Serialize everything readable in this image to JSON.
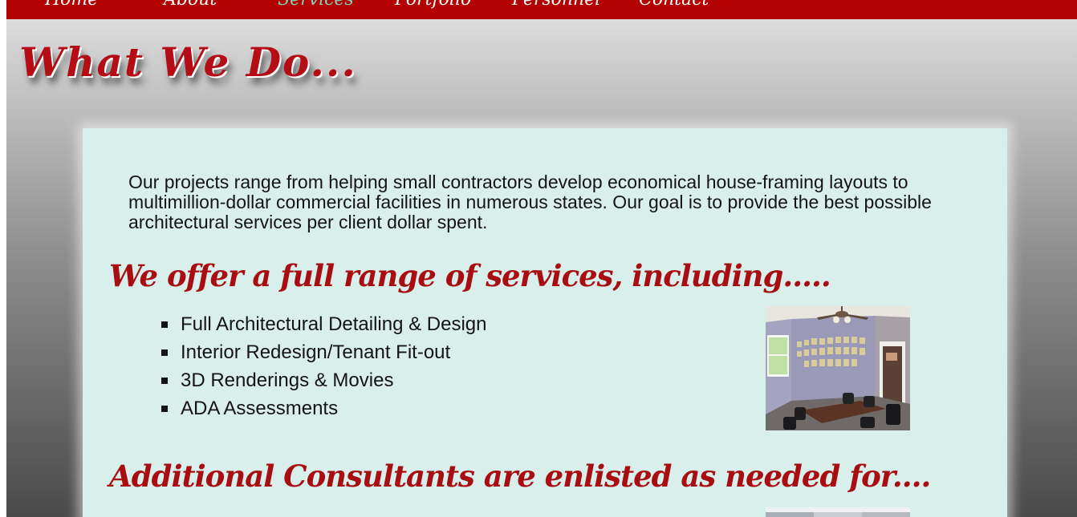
{
  "nav": {
    "items": [
      {
        "label": "Home"
      },
      {
        "label": "About"
      },
      {
        "label": "Services",
        "active": true
      },
      {
        "label": "Portfolio"
      },
      {
        "label": "Personnel"
      },
      {
        "label": "Contact"
      }
    ]
  },
  "page_title": "What We Do...",
  "intro_text": "Our projects range from helping small contractors develop economical house-framing layouts to multimillion-dollar commercial facilities in numerous states. Our goal is to provide the best possible architectural services per client dollar spent.",
  "services": {
    "heading": "We offer a full range of services, including.....",
    "items": [
      "Full Architectural Detailing & Design",
      "Interior Redesign/Tenant Fit-out",
      "3D Renderings & Movies",
      "ADA Assessments"
    ]
  },
  "consultants": {
    "heading": "Additional Consultants are enlisted as needed for...."
  },
  "colors": {
    "nav_bar": "#b30000",
    "nav_active": "#7fd6bb",
    "heading_red": "#a80d11",
    "panel": "#d9efeb"
  }
}
